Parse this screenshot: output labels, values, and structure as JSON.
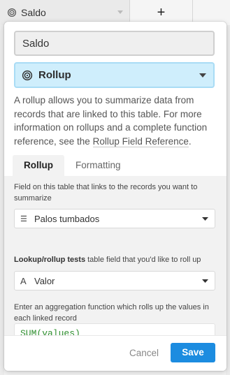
{
  "background": {
    "field_header": {
      "label": "Saldo",
      "icon": "rollup-icon"
    },
    "add_field_label": "+"
  },
  "dialog": {
    "field_name": "Saldo",
    "field_type": {
      "label": "Rollup",
      "icon": "rollup-spiral-icon"
    },
    "description_text": "A rollup allows you to summarize data from records that are linked to this table. For more information on rollups and a complete function reference, see the ",
    "description_link": "Rollup Field Reference",
    "description_end": ".",
    "tabs": [
      {
        "label": "Rollup",
        "active": true
      },
      {
        "label": "Formatting",
        "active": false
      }
    ],
    "link_field": {
      "label": "Field on this table that links to the records you want to summarize",
      "value": "Palos tumbados",
      "icon": "linked-records-icon"
    },
    "lookup_field": {
      "label_bold": "Lookup/rollup tests",
      "label_rest": " table field that you'd like to roll up",
      "value": "Valor",
      "icon": "text-field-icon"
    },
    "aggregation": {
      "label": "Enter an aggregation function which rolls up the values in each linked record",
      "formula": "SUM(values)"
    },
    "cancel_label": "Cancel",
    "save_label": "Save"
  },
  "colors": {
    "accent": "#1c8ce0",
    "type_select_bg": "#cfeefc",
    "formula_text": "#2f8f2f"
  }
}
